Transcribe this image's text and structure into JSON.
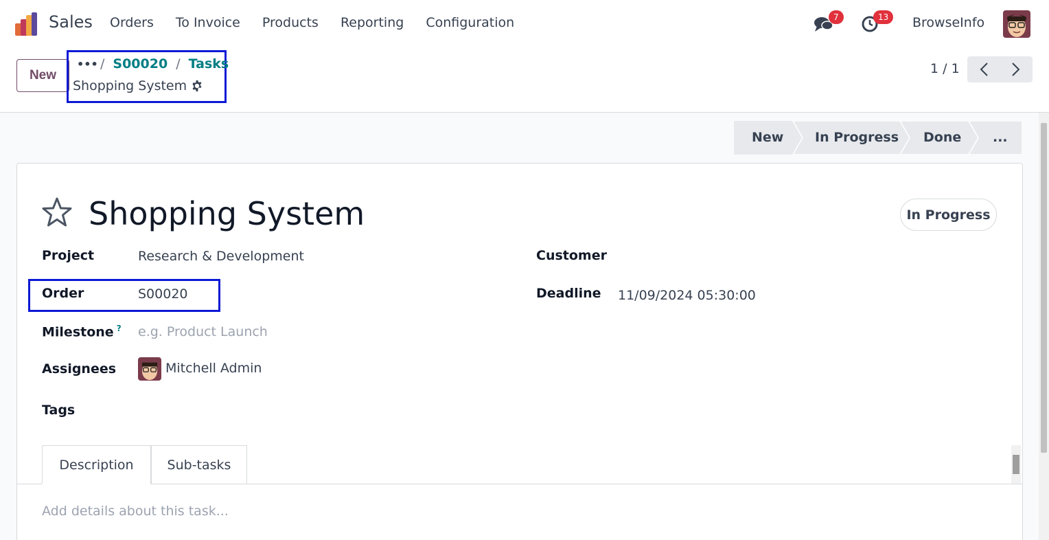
{
  "app": {
    "name": "Sales"
  },
  "menu": [
    "Orders",
    "To Invoice",
    "Products",
    "Reporting",
    "Configuration"
  ],
  "systray": {
    "messages_count": "7",
    "activities_count": "13",
    "company": "BrowseInfo"
  },
  "control": {
    "new_label": "New",
    "breadcrumb": {
      "dots": "•••",
      "sep": "/",
      "order": "S00020",
      "tasks": "Tasks",
      "current": "Shopping System"
    },
    "pager": "1 / 1"
  },
  "stages": [
    "New",
    "In Progress",
    "Done",
    "..."
  ],
  "task": {
    "title": "Shopping System",
    "state": "In Progress",
    "fields": {
      "project_label": "Project",
      "project_value": "Research & Development",
      "order_label": "Order",
      "order_value": "S00020",
      "milestone_label": "Milestone",
      "milestone_help": "?",
      "milestone_placeholder": "e.g. Product Launch",
      "assignees_label": "Assignees",
      "assignees_value": "Mitchell Admin",
      "tags_label": "Tags",
      "customer_label": "Customer",
      "deadline_label": "Deadline",
      "deadline_value": "11/09/2024 05:30:00"
    },
    "tabs": [
      "Description",
      "Sub-tasks"
    ],
    "description_placeholder": "Add details about this task..."
  },
  "colors": {
    "brand": "#714b67",
    "link": "#017e84",
    "highlight_box": "#0c19d4",
    "badge": "#e0313c"
  },
  "icons": [
    "odoo-sales-logo-icon",
    "chat-icon",
    "clock-icon",
    "gear-icon",
    "star-icon",
    "chevron-left-icon",
    "chevron-right-icon"
  ]
}
